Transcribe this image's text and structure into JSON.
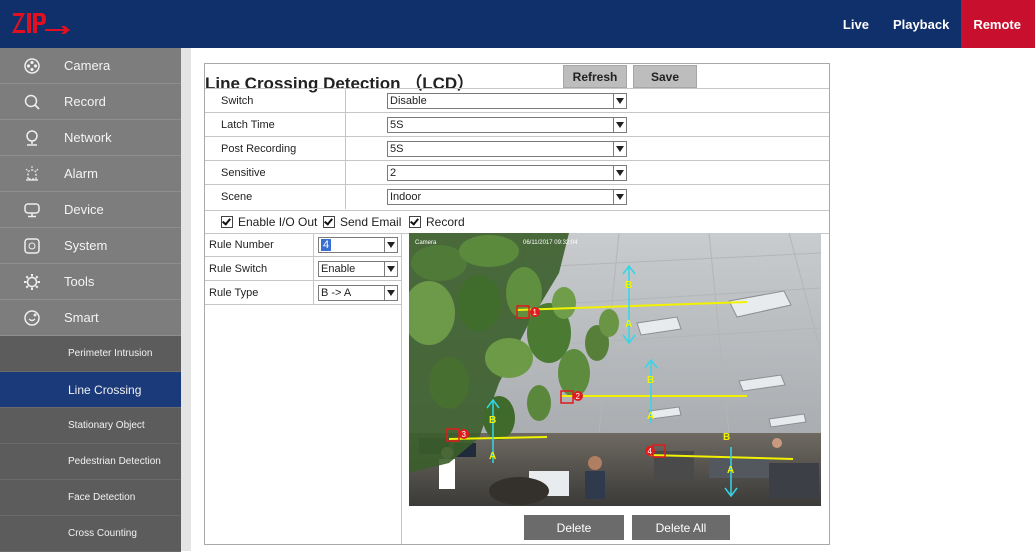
{
  "header": {
    "nav": [
      "Live",
      "Playback",
      "Remote"
    ]
  },
  "sidebar": {
    "items": [
      {
        "label": "Camera",
        "icon": "camera-icon"
      },
      {
        "label": "Record",
        "icon": "search-icon"
      },
      {
        "label": "Network",
        "icon": "pin-icon"
      },
      {
        "label": "Alarm",
        "icon": "alarm-icon"
      },
      {
        "label": "Device",
        "icon": "device-icon"
      },
      {
        "label": "System",
        "icon": "system-icon"
      },
      {
        "label": "Tools",
        "icon": "gear-icon"
      },
      {
        "label": "Smart",
        "icon": "smart-icon"
      }
    ],
    "subitems": [
      "Perimeter Intrusion",
      "Line Crossing",
      "Stationary Object",
      "Pedestrian Detection",
      "Face Detection",
      "Cross Counting"
    ],
    "active_subitem": "Line Crossing"
  },
  "panel": {
    "title": "Line Crossing Detection （LCD）",
    "refresh_label": "Refresh",
    "save_label": "Save",
    "settings": [
      {
        "label": "Switch",
        "value": "Disable"
      },
      {
        "label": "Latch Time",
        "value": "5S"
      },
      {
        "label": "Post Recording",
        "value": "5S"
      },
      {
        "label": "Sensitive",
        "value": "2"
      },
      {
        "label": "Scene",
        "value": "Indoor"
      }
    ],
    "checkboxes": [
      {
        "label": "Enable I/O Out",
        "checked": true
      },
      {
        "label": "Send Email",
        "checked": true
      },
      {
        "label": "Record",
        "checked": true
      }
    ],
    "rules": [
      {
        "label": "Rule Number",
        "value": "4"
      },
      {
        "label": "Rule Switch",
        "value": "Enable"
      },
      {
        "label": "Rule Type",
        "value": "B -> A"
      }
    ],
    "video": {
      "camera_label": "Camera",
      "timestamp": "06/11/2017 09:32:04",
      "lines": [
        {
          "number": "1",
          "side_b": "B",
          "side_a": "A"
        },
        {
          "number": "2",
          "side_b": "B",
          "side_a": "A"
        },
        {
          "number": "3",
          "side_b": "B",
          "side_a": "A"
        },
        {
          "number": "4",
          "side_b": "B",
          "side_a": "A"
        }
      ]
    },
    "delete_label": "Delete",
    "delete_all_label": "Delete All"
  },
  "colors": {
    "topbar": "#10306b",
    "accent": "#c8102e",
    "line": "#f2f200",
    "arrow": "#33d6e6",
    "sidebar": "#7d7d7d",
    "active_sub": "#1a3a7a"
  }
}
